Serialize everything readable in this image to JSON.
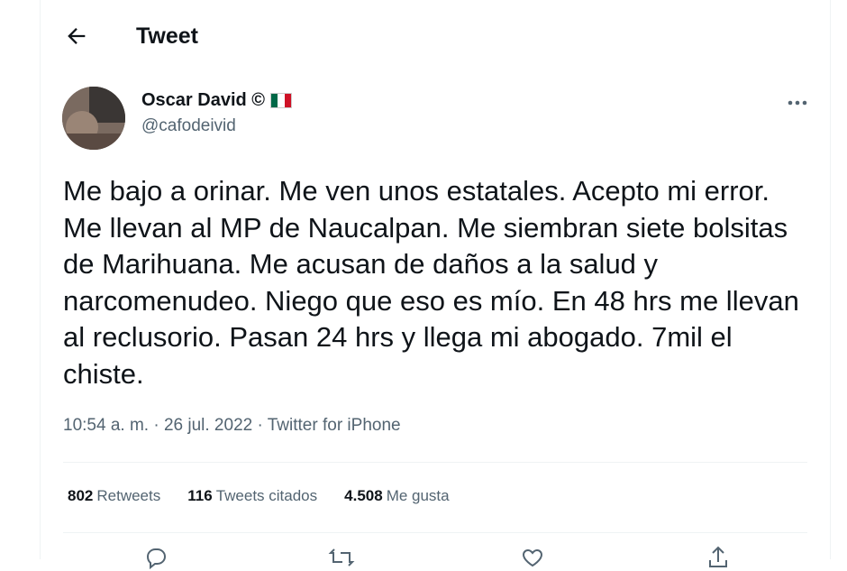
{
  "header": {
    "title": "Tweet"
  },
  "author": {
    "name": "Oscar David ©",
    "handle": "@cafodeivid"
  },
  "tweet": {
    "text": "Me bajo a orinar. Me ven unos estatales. Acepto mi error. Me llevan al MP de Naucalpan. Me siembran siete bolsitas de Marihuana. Me acusan de daños a la salud y narcomenudeo. Niego que eso es mío. En 48 hrs me llevan al reclusorio. Pasan 24 hrs y llega mi abogado. 7mil el chiste.",
    "time": "10:54 a. m.",
    "separator": " · ",
    "date": "26 jul. 2022",
    "source": "Twitter for iPhone"
  },
  "stats": {
    "retweets": {
      "count": "802",
      "label": "Retweets"
    },
    "quotes": {
      "count": "116",
      "label": "Tweets citados"
    },
    "likes": {
      "count": "4.508",
      "label": "Me gusta"
    }
  },
  "icons": [
    "back-arrow-icon",
    "more-icon",
    "mexico-flag-icon",
    "reply-icon",
    "retweet-icon",
    "like-icon",
    "share-icon"
  ],
  "colors": {
    "text": "#0f1419",
    "secondary": "#536471",
    "divider": "#eff3f4",
    "flag_green": "#006847",
    "flag_red": "#ce1126"
  }
}
